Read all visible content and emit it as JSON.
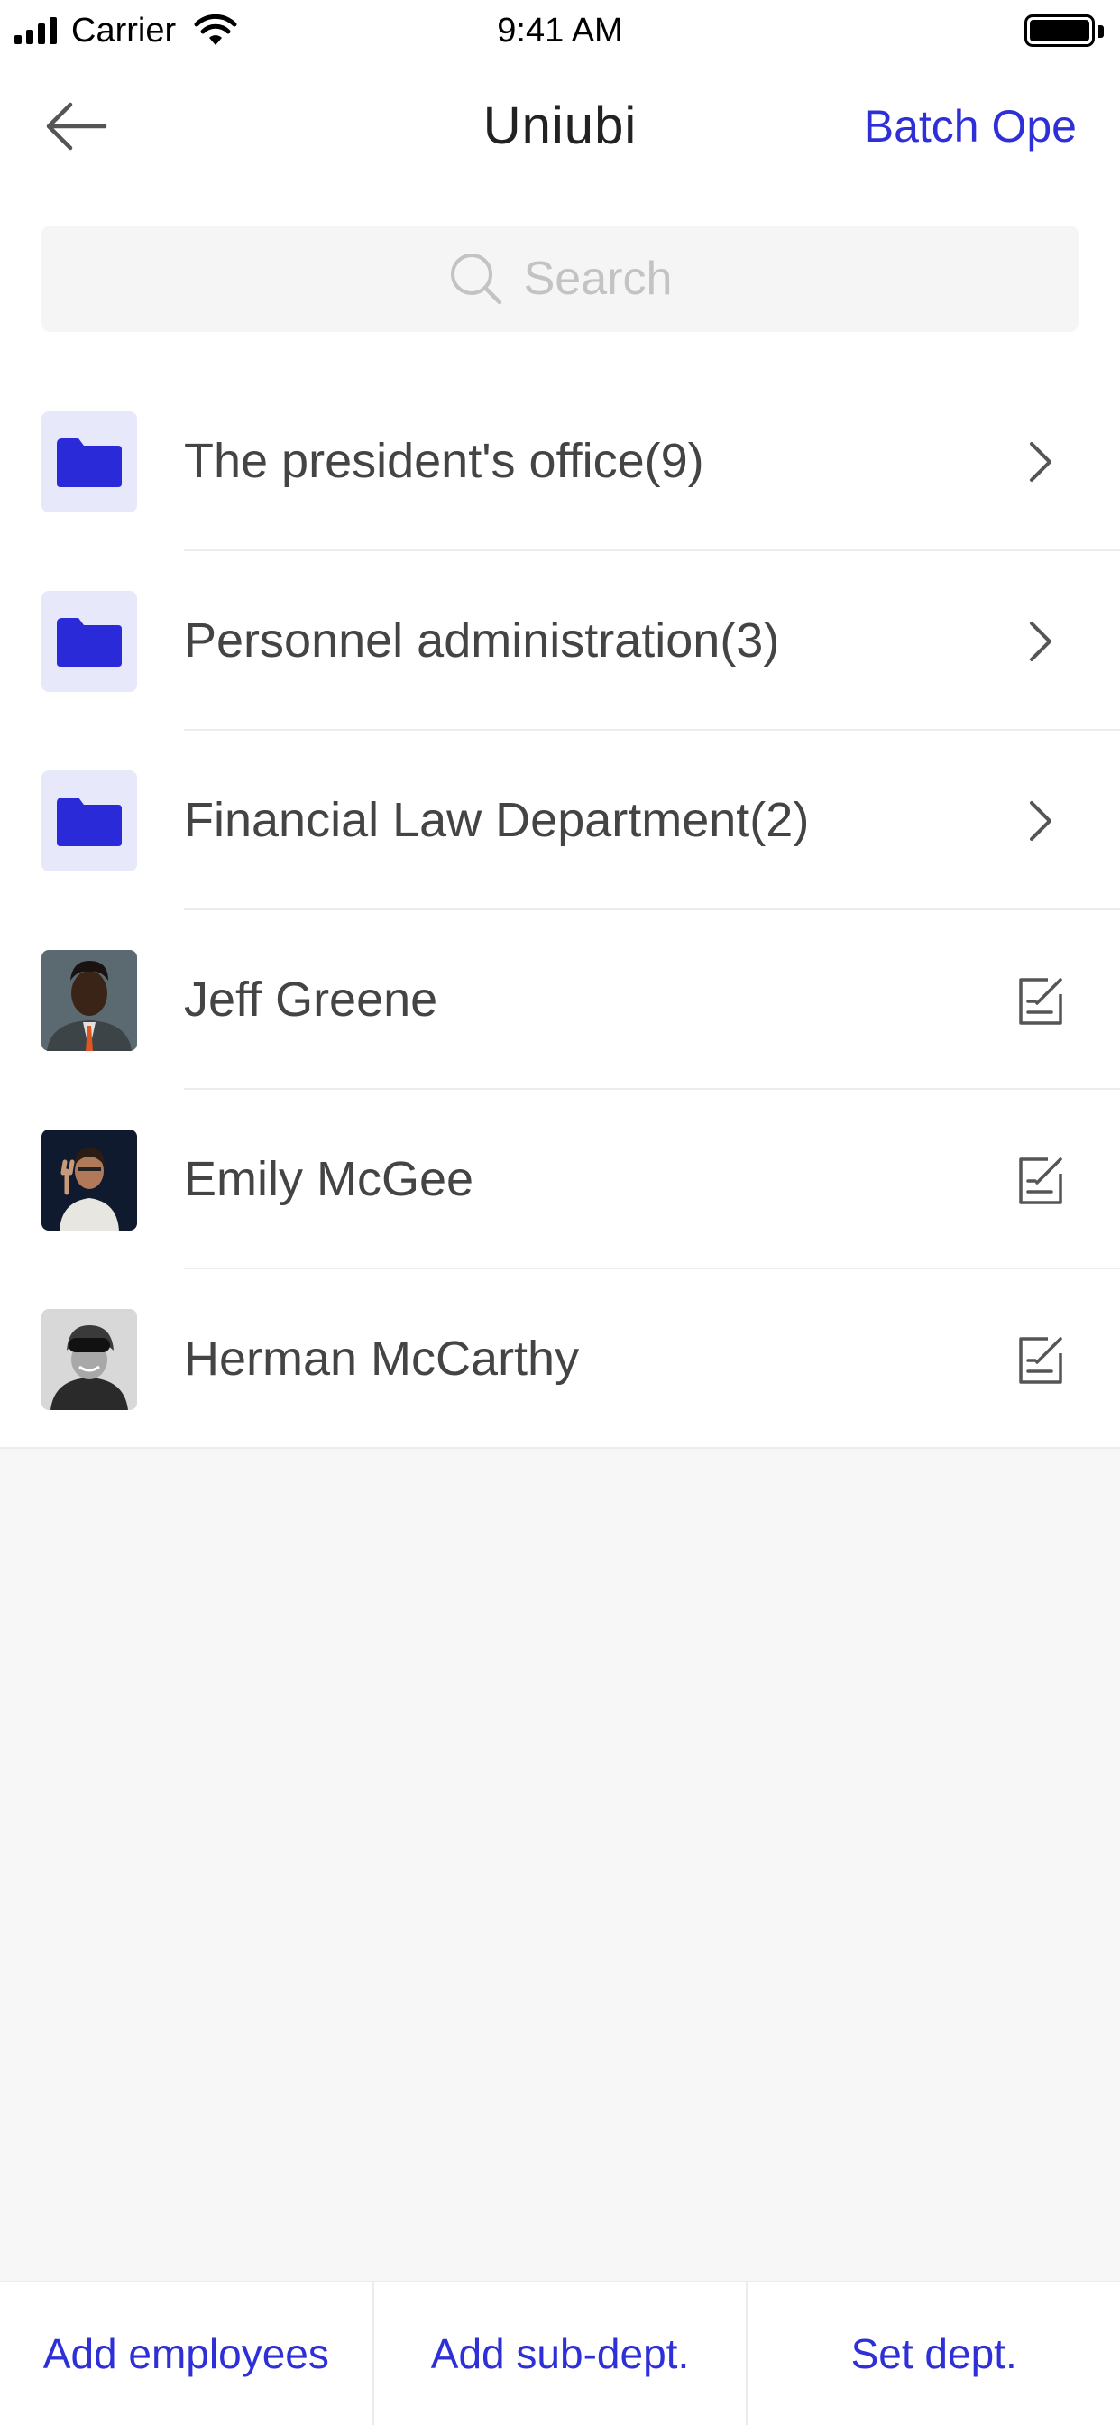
{
  "status_bar": {
    "carrier": "Carrier",
    "time": "9:41 AM"
  },
  "nav": {
    "title": "Uniubi",
    "action_label": "Batch Ope"
  },
  "search": {
    "placeholder": "Search"
  },
  "departments": [
    {
      "label": "The president's office(9)",
      "icon": "folder-icon"
    },
    {
      "label": "Personnel administration(3)",
      "icon": "folder-icon"
    },
    {
      "label": "Financial Law Department(2)",
      "icon": "folder-icon"
    }
  ],
  "employees": [
    {
      "name": "Jeff Greene"
    },
    {
      "name": "Emily McGee"
    },
    {
      "name": "Herman McCarthy"
    }
  ],
  "bottom_bar": {
    "add_employees": "Add employees",
    "add_sub_dept": "Add sub-dept.",
    "set_dept": "Set dept."
  },
  "colors": {
    "accent": "#2e2fd6",
    "folder": "#2a2ad8",
    "folder_bg": "#e8e8fb"
  }
}
